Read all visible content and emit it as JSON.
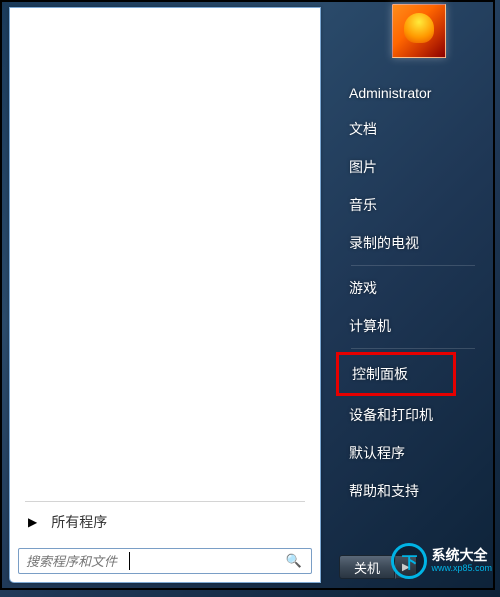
{
  "startMenu": {
    "allPrograms": "所有程序",
    "search": {
      "placeholder": "搜索程序和文件"
    },
    "accountName": "Administrator",
    "rightItems": [
      {
        "label": "文档"
      },
      {
        "label": "图片"
      },
      {
        "label": "音乐"
      },
      {
        "label": "录制的电视"
      },
      {
        "label": "游戏"
      },
      {
        "label": "计算机"
      },
      {
        "label": "控制面板",
        "highlighted": true
      },
      {
        "label": "设备和打印机"
      },
      {
        "label": "默认程序"
      },
      {
        "label": "帮助和支持"
      }
    ],
    "shutdown": {
      "label": "关机"
    }
  },
  "watermark": {
    "logo": "下",
    "name": "系统大全",
    "url": "www.xp85.com"
  }
}
